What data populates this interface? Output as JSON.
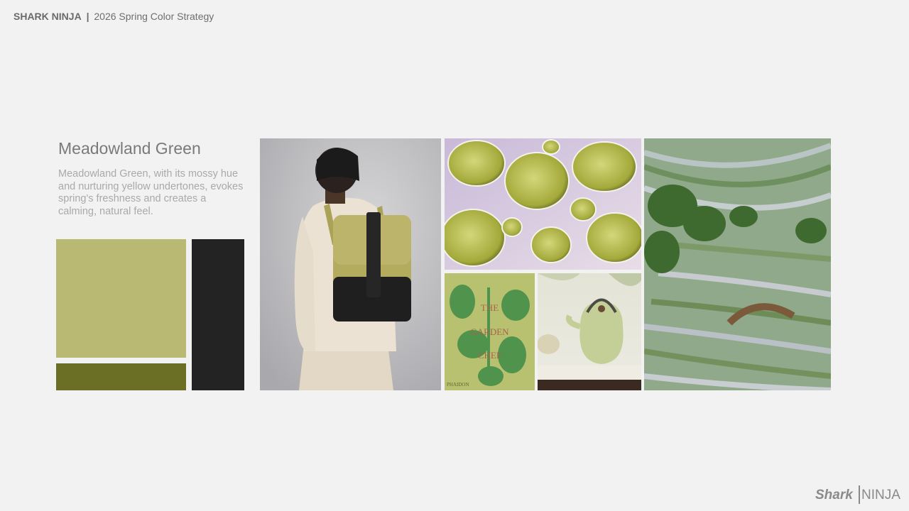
{
  "header": {
    "brand": "SHARK NINJA",
    "separator": "|",
    "subtitle": "2026 Spring Color Strategy"
  },
  "color": {
    "title": "Meadowland Green",
    "description": "Meadowland Green, with its mossy hue and nurturing yellow undertones, evokes spring's freshness and creates a calming, natural feel.",
    "swatches": [
      {
        "name": "light-green",
        "hex": "#b9b973"
      },
      {
        "name": "dark-olive",
        "hex": "#6b6e25"
      },
      {
        "name": "charcoal",
        "hex": "#232323"
      }
    ]
  },
  "book": {
    "line1": "THE",
    "line2": "GARDEN",
    "line3": "CHEF",
    "publisher": "PHAIDON"
  },
  "footer_logo": {
    "word1": "Shark",
    "word2": "NINJA"
  }
}
